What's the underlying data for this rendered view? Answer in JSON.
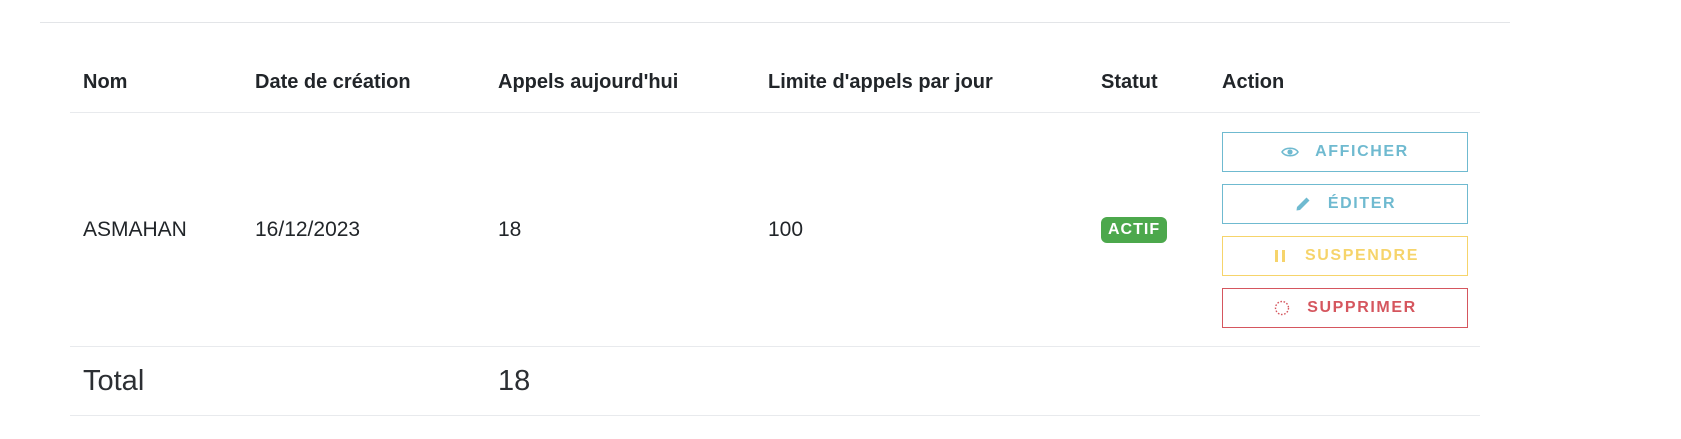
{
  "table": {
    "headers": {
      "name": "Nom",
      "created": "Date de création",
      "calls_today": "Appels aujourd'hui",
      "daily_limit": "Limite d'appels par jour",
      "status": "Statut",
      "action": "Action"
    },
    "rows": [
      {
        "name": "ASMAHAN",
        "created": "16/12/2023",
        "calls_today": "18",
        "daily_limit": "100",
        "status": "ACTIF",
        "actions": {
          "view": "AFFICHER",
          "edit": "ÉDITER",
          "suspend": "SUSPENDRE",
          "delete": "SUPPRIMER"
        }
      }
    ],
    "total": {
      "label": "Total",
      "calls_today": "18"
    }
  },
  "icons": {
    "view": "eye-icon",
    "edit": "pencil-icon",
    "suspend": "pause-icon",
    "delete": "circle-dashed-icon"
  },
  "colors": {
    "status_active": "#4ca84c",
    "view": "#6fbad0",
    "edit": "#6fbad0",
    "suspend": "#f6d46b",
    "delete": "#d5565e"
  }
}
